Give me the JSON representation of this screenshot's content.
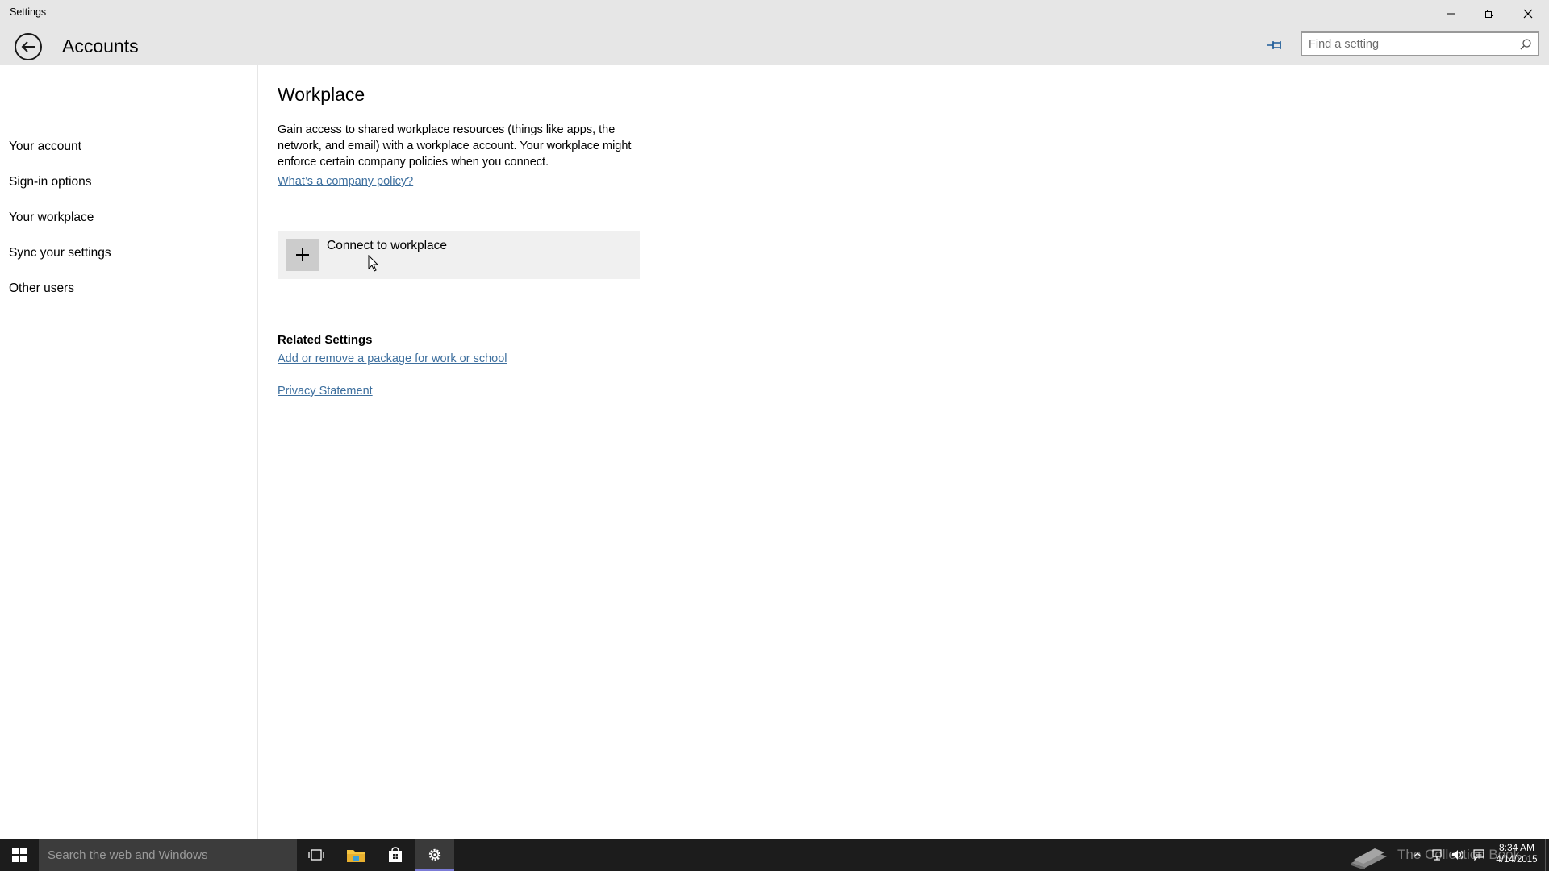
{
  "window": {
    "title": "Settings",
    "minimize_label": "Minimize",
    "maximize_label": "Restore",
    "close_label": "Close"
  },
  "header": {
    "title": "Accounts",
    "search_placeholder": "Find a setting"
  },
  "sidebar": {
    "items": [
      {
        "label": "Your account"
      },
      {
        "label": "Sign-in options"
      },
      {
        "label": "Your workplace"
      },
      {
        "label": "Sync your settings"
      },
      {
        "label": "Other users"
      }
    ]
  },
  "main": {
    "title": "Workplace",
    "description": "Gain access to shared workplace resources (things like apps, the network, and email) with a workplace account. Your workplace might enforce certain company policies when you connect.",
    "policy_link": "What’s a company policy?",
    "connect_button": "Connect to workplace",
    "related_heading": "Related Settings",
    "related_link": "Add or remove a package for work or school",
    "privacy_link": "Privacy Statement"
  },
  "taskbar": {
    "search_placeholder": "Search the web and Windows",
    "watermark": "The Collection Book",
    "clock_time": "8:34 AM",
    "clock_date": "4/14/2015"
  },
  "colors": {
    "chrome": "#e6e6e6",
    "link": "#3d6f9e",
    "taskbar": "#1c1c1c",
    "active_app": "#7b7bd6"
  }
}
